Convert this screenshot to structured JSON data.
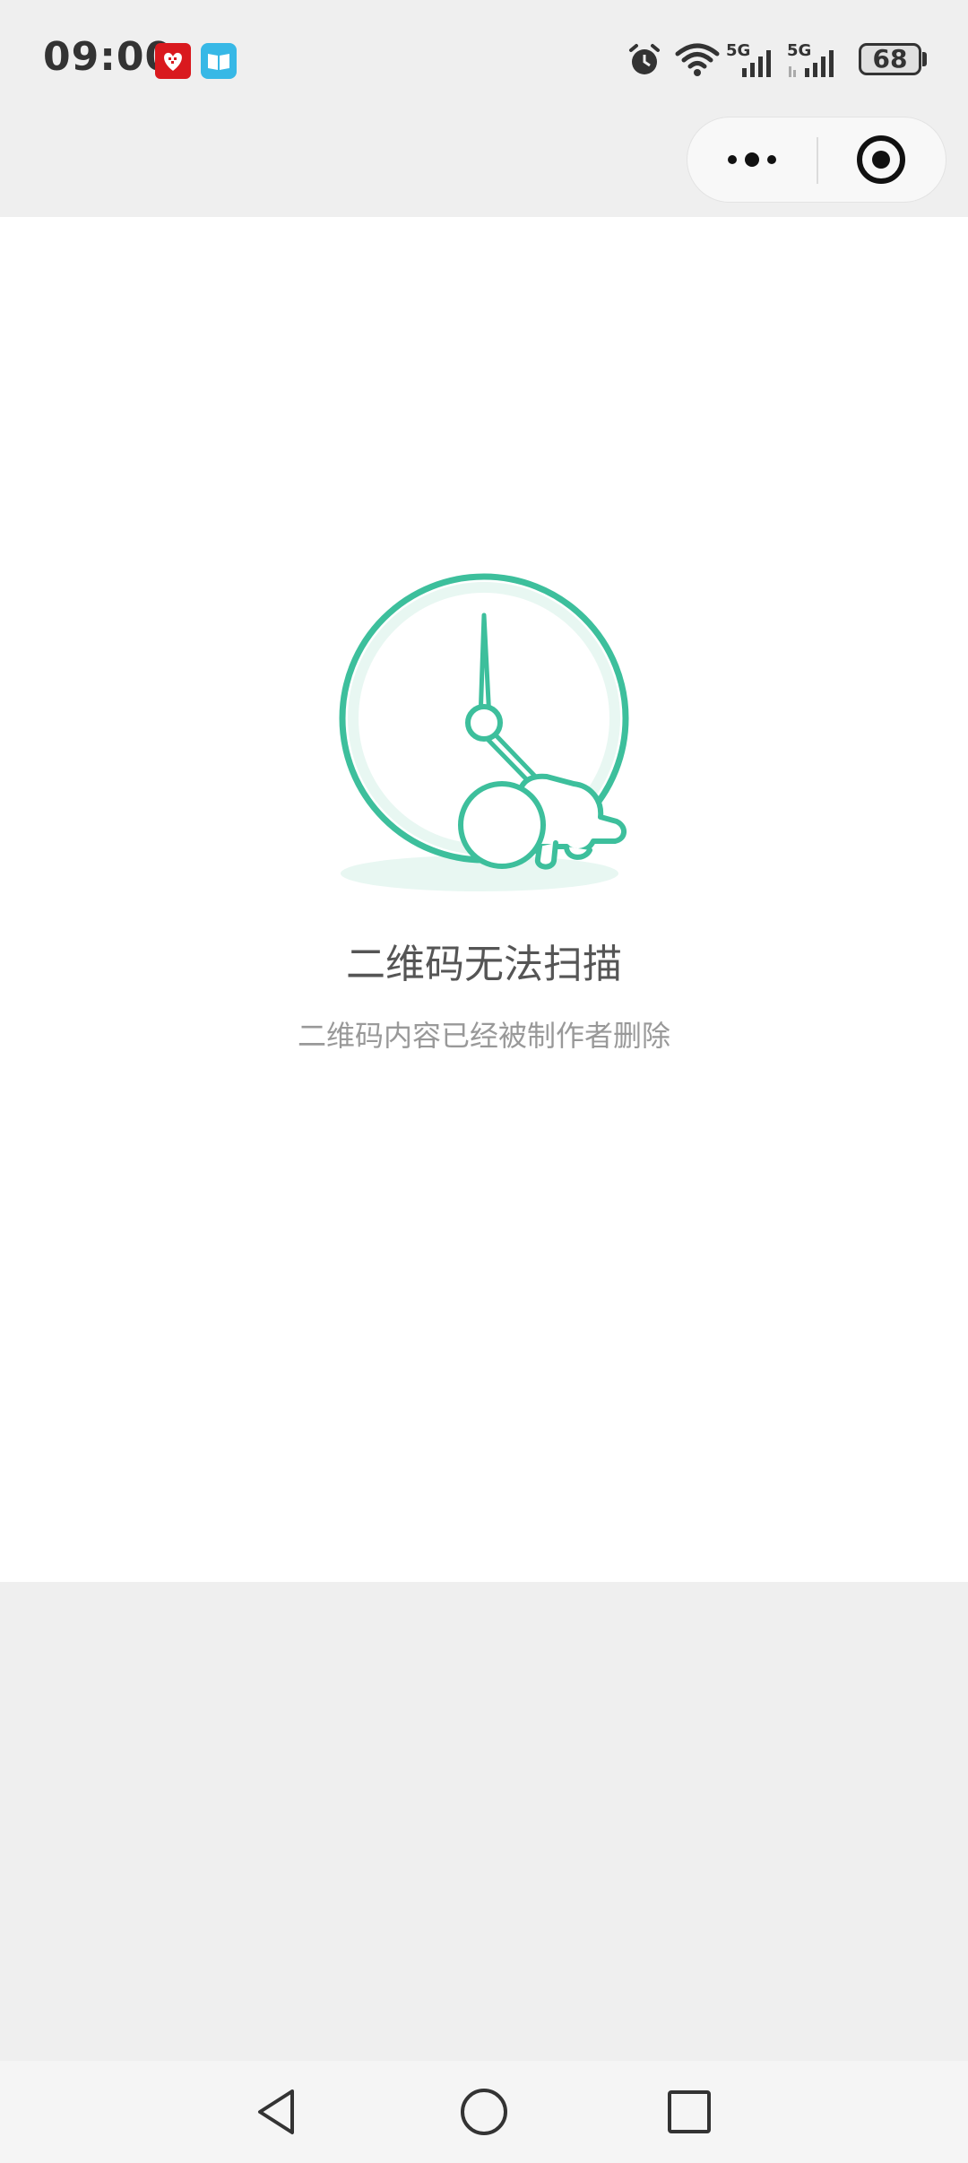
{
  "status_bar": {
    "time": "09:00",
    "battery": "68",
    "icons": [
      "app-red-icon",
      "book-app-icon",
      "alarm-icon",
      "wifi-icon",
      "5g-signal-icon",
      "5g-signal-icon"
    ]
  },
  "capsule": {
    "more_icon": "more-dots-icon",
    "close_icon": "target-close-icon"
  },
  "main": {
    "illustration_icon": "clock-sleeping-baby-icon",
    "title": "二维码无法扫描",
    "subtitle": "二维码内容已经被制作者删除"
  },
  "nav": {
    "icons": [
      "back-triangle-icon",
      "home-circle-icon",
      "recents-square-icon"
    ]
  },
  "colors": {
    "accent": "#3dbf9c",
    "accent_light": "#e8f7f2",
    "background": "#efefef",
    "content_background": "#ffffff"
  }
}
